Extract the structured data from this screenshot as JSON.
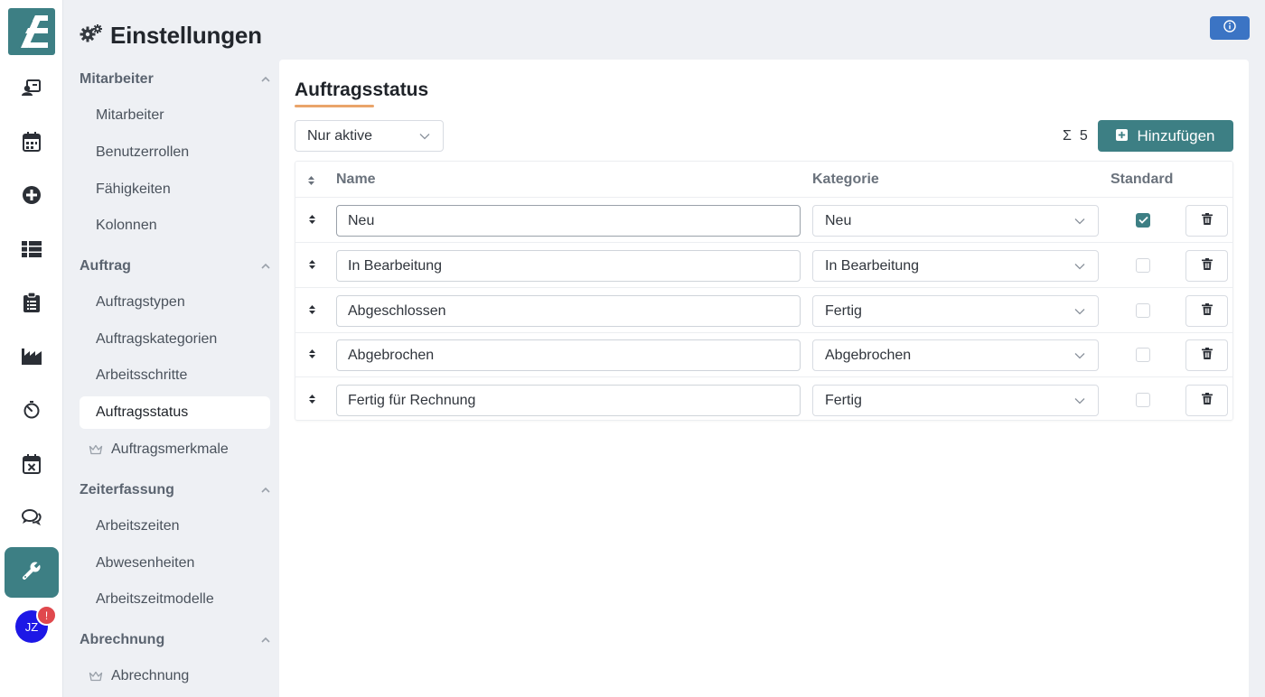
{
  "app": {
    "accent_color": "#3d7f84",
    "underline_color": "#e9a46a"
  },
  "rail": {
    "items": [
      {
        "name": "contacts-icon",
        "active": false
      },
      {
        "name": "calendar-icon",
        "active": false
      },
      {
        "name": "plus-circle-icon",
        "active": false
      },
      {
        "name": "list-icon",
        "active": false
      },
      {
        "name": "clipboard-icon",
        "active": false
      },
      {
        "name": "chart-icon",
        "active": false
      },
      {
        "name": "timer-icon",
        "active": false
      },
      {
        "name": "calendar-x-icon",
        "active": false
      },
      {
        "name": "chat-icon",
        "active": false
      },
      {
        "name": "wrench-icon",
        "active": true
      }
    ],
    "avatar_initials": "JZ",
    "notification_badge": "!"
  },
  "header": {
    "title": "Einstellungen"
  },
  "menu": {
    "groups": [
      {
        "label": "Mitarbeiter",
        "items": [
          "Mitarbeiter",
          "Benutzerrollen",
          "Fähigkeiten",
          "Kolonnen"
        ]
      },
      {
        "label": "Auftrag",
        "items": [
          "Auftragstypen",
          "Auftragskategorien",
          "Arbeitsschritte",
          "Auftragsstatus",
          "Auftragsmerkmale"
        ],
        "active_item": "Auftragsstatus",
        "premium_items": [
          "Auftragsmerkmale"
        ]
      },
      {
        "label": "Zeiterfassung",
        "items": [
          "Arbeitszeiten",
          "Abwesenheiten",
          "Arbeitszeitmodelle"
        ]
      },
      {
        "label": "Abrechnung",
        "items": [
          "Abrechnung"
        ],
        "premium_items": [
          "Abrechnung"
        ]
      }
    ]
  },
  "main": {
    "title": "Auftragsstatus",
    "filter": {
      "selected": "Nur aktive"
    },
    "count_symbol": "Σ",
    "count": "5",
    "add_button": "Hinzufügen",
    "table": {
      "columns": {
        "name": "Name",
        "category": "Kategorie",
        "default": "Standard"
      },
      "rows": [
        {
          "name": "Neu",
          "category": "Neu",
          "default": true
        },
        {
          "name": "In Bearbeitung",
          "category": "In Bearbeitung",
          "default": false
        },
        {
          "name": "Abgeschlossen",
          "category": "Fertig",
          "default": false
        },
        {
          "name": "Abgebrochen",
          "category": "Abgebrochen",
          "default": false
        },
        {
          "name": "Fertig für Rechnung",
          "category": "Fertig",
          "default": false
        }
      ]
    }
  }
}
